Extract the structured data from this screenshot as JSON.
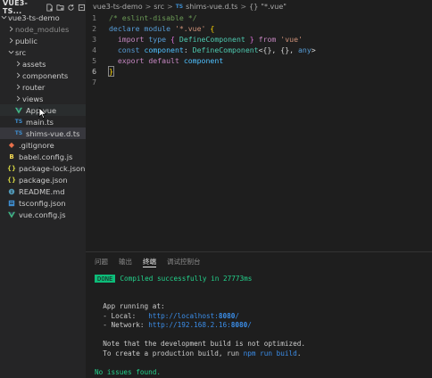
{
  "sidebar": {
    "title": "VUE3-TS...",
    "header_icons": [
      "new-file-icon",
      "new-folder-icon",
      "refresh-icon",
      "collapse-all-icon"
    ],
    "items": [
      {
        "label": "vue3-ts-demo",
        "type": "folder-open",
        "depth": 0
      },
      {
        "label": "node_modules",
        "type": "folder",
        "depth": 1,
        "dim": true
      },
      {
        "label": "public",
        "type": "folder",
        "depth": 1
      },
      {
        "label": "src",
        "type": "folder-open",
        "depth": 1
      },
      {
        "label": "assets",
        "type": "folder",
        "depth": 2
      },
      {
        "label": "components",
        "type": "folder",
        "depth": 2
      },
      {
        "label": "router",
        "type": "folder",
        "depth": 2
      },
      {
        "label": "views",
        "type": "folder",
        "depth": 2
      },
      {
        "label": "App.vue",
        "type": "vue",
        "depth": 2
      },
      {
        "label": "main.ts",
        "type": "ts",
        "depth": 2
      },
      {
        "label": "shims-vue.d.ts",
        "type": "ts",
        "depth": 2,
        "selected": true
      },
      {
        "label": ".gitignore",
        "type": "git",
        "depth": 1
      },
      {
        "label": "babel.config.js",
        "type": "js",
        "depth": 1
      },
      {
        "label": "package-lock.json",
        "type": "json",
        "depth": 1
      },
      {
        "label": "package.json",
        "type": "json",
        "depth": 1
      },
      {
        "label": "README.md",
        "type": "md",
        "depth": 1
      },
      {
        "label": "tsconfig.json",
        "type": "tsconfig",
        "depth": 1
      },
      {
        "label": "vue.config.js",
        "type": "vueconfig",
        "depth": 1
      }
    ]
  },
  "breadcrumb": {
    "parts": [
      "vue3-ts-demo",
      "src"
    ],
    "file": "shims-vue.d.ts",
    "file_badge": "TS",
    "symbol": "\"*.vue\"",
    "symbol_icon": "{}",
    "separator": ">"
  },
  "code": {
    "line_numbers": [
      "1",
      "2",
      "3",
      "4",
      "5",
      "6",
      "7"
    ],
    "l1": "/* eslint-disable */",
    "l2_kw": "declare module ",
    "l2_str": "'*.vue'",
    "l2_brace": " {",
    "l3_kw": "import ",
    "l3_type_kw": "type ",
    "l3_open": "{ ",
    "l3_name": "DefineComponent",
    "l3_close": " } ",
    "l3_from": "from ",
    "l3_str": "'vue'",
    "l4_kw": "const ",
    "l4_var": "component",
    "l4_colon": ": ",
    "l4_type": "DefineComponent",
    "l4_args": "<{}, {}, ",
    "l4_any": "any",
    "l4_end": ">",
    "l5_kw": "export default ",
    "l5_var": "component",
    "l6": "}"
  },
  "panel": {
    "tabs": [
      "问题",
      "输出",
      "终端",
      "调试控制台"
    ],
    "active_tab": "终端",
    "terminal": {
      "done_badge": "DONE",
      "compiled": "Compiled successfully in 27773ms",
      "running": "App running at:",
      "local_label": "- Local:   ",
      "local_url_pre": "http://localhost:",
      "local_port": "8080",
      "local_url_post": "/",
      "network_label": "- Network: ",
      "network_url_pre": "http://192.168.2.16:",
      "network_port": "8080",
      "network_url_post": "/",
      "note1": "Note that the development build is not optimized.",
      "note2_pre": "To create a production build, run ",
      "note2_cmd": "npm run build",
      "note2_post": ".",
      "no_issues": "No issues found."
    }
  },
  "colors": {
    "bg": "#1e1e1e",
    "sidebar_bg": "#252526",
    "done_green": "#0dbc79",
    "link_blue": "#3b8eea",
    "success_green": "#23d18b"
  }
}
